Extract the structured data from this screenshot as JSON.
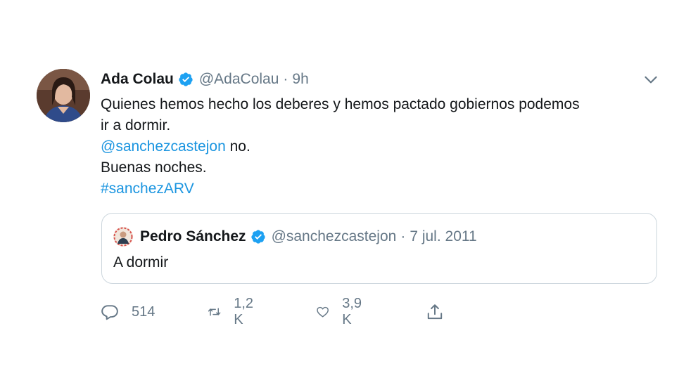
{
  "tweet": {
    "author_name": "Ada Colau",
    "author_handle": "@AdaColau",
    "separator": "·",
    "time": "9h",
    "text_line1": "Quienes hemos hecho los deberes y hemos pactado gobiernos podemos",
    "text_line2": "ir a dormir.",
    "mention": "@sanchezcastejon",
    "mention_suffix": " no.",
    "text_line4": "Buenas noches.",
    "hashtag": "#sanchezARV"
  },
  "quoted_tweet": {
    "author_name": "Pedro Sánchez",
    "author_handle": "@sanchezcastejon",
    "separator": "·",
    "date": "7 jul. 2011",
    "text": "A dormir"
  },
  "actions": {
    "replies": "514",
    "retweets": "1,2 K",
    "likes": "3,9 K"
  },
  "icons": {
    "verified": "verified-badge-icon",
    "menu": "chevron-down-icon",
    "reply": "reply-icon",
    "retweet": "retweet-icon",
    "like": "heart-icon",
    "share": "share-icon"
  },
  "colors": {
    "link": "#1b95e0",
    "secondary_text": "#657786",
    "primary_text": "#14171a",
    "verified": "#1da1f2",
    "border": "#ccd6dd"
  }
}
